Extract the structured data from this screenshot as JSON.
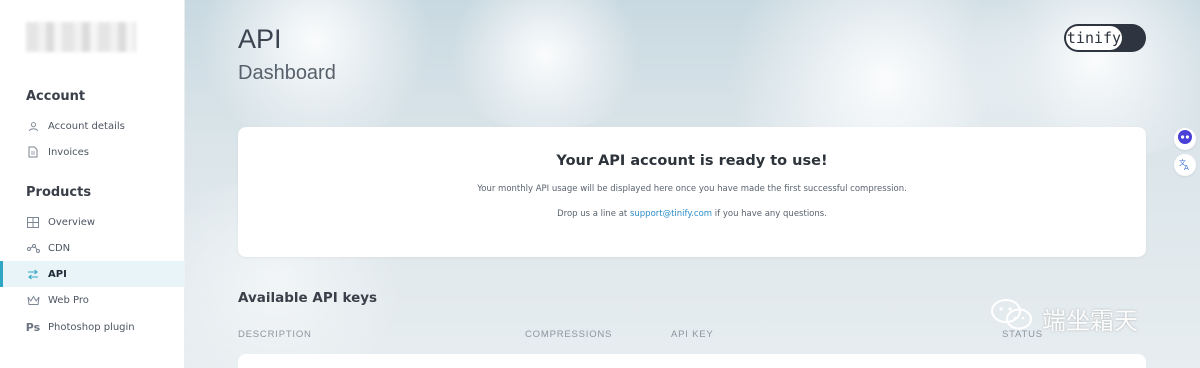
{
  "sidebar": {
    "sections": [
      {
        "title": "Account",
        "items": [
          {
            "label": "Account details",
            "icon": "user-icon"
          },
          {
            "label": "Invoices",
            "icon": "document-icon"
          }
        ]
      },
      {
        "title": "Products",
        "items": [
          {
            "label": "Overview",
            "icon": "grid-icon"
          },
          {
            "label": "CDN",
            "icon": "network-icon"
          },
          {
            "label": "API",
            "icon": "swap-icon",
            "active": true
          },
          {
            "label": "Web Pro",
            "icon": "crown-icon"
          },
          {
            "label": "Photoshop plugin",
            "icon": "photoshop-icon",
            "icon_text": "Ps"
          }
        ]
      }
    ]
  },
  "header": {
    "title": "API",
    "subtitle": "Dashboard",
    "brand": "tinify"
  },
  "notice": {
    "title": "Your API account is ready to use!",
    "line1": "Your monthly API usage will be displayed here once you have made the first successful compression.",
    "line2_prefix": "Drop us a line at ",
    "line2_link": "support@tinify.com",
    "line2_suffix": " if you have any questions."
  },
  "keys": {
    "title": "Available API keys",
    "columns": [
      "DESCRIPTION",
      "COMPRESSIONS",
      "API KEY",
      "STATUS"
    ]
  },
  "watermark": {
    "text": "端坐霜天"
  },
  "colors": {
    "accent": "#2fa6c4",
    "link": "#2b8ec9",
    "dark": "#2e3540"
  }
}
